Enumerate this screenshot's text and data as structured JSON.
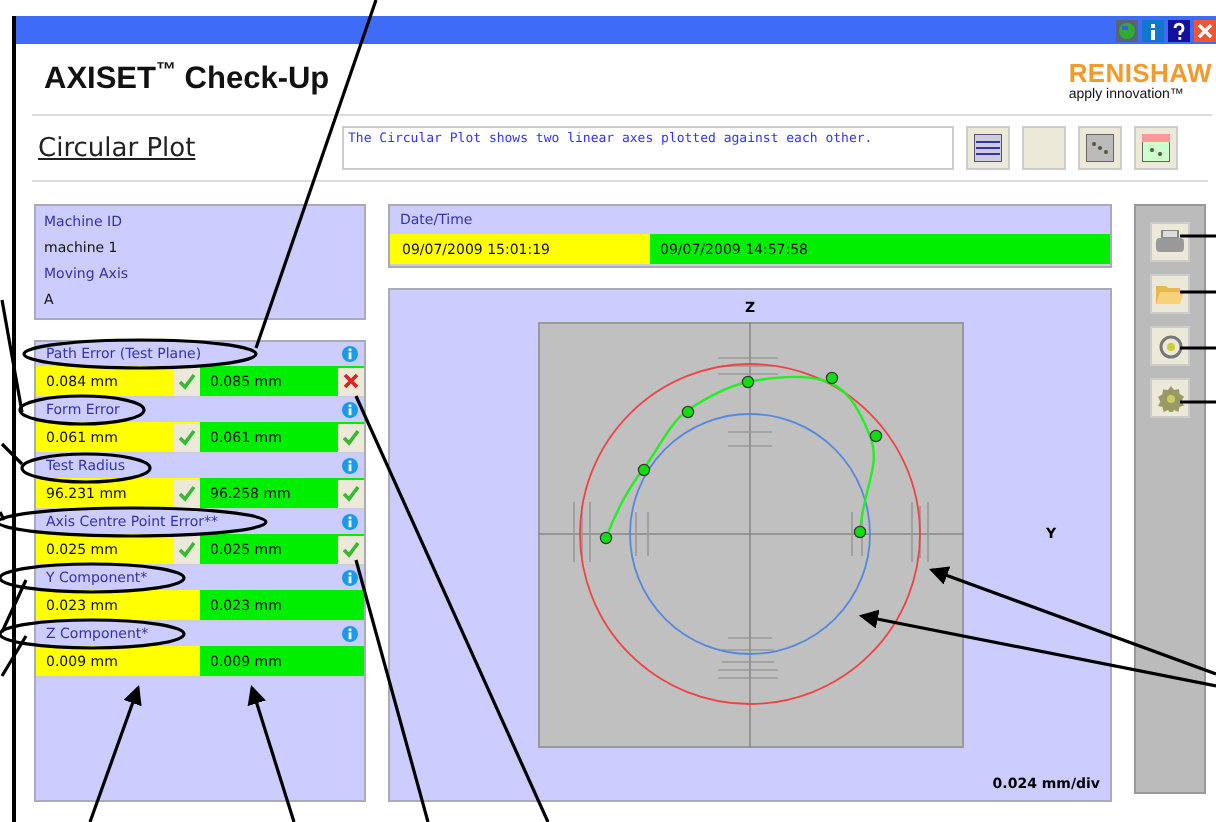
{
  "window": {
    "title_buttons": [
      {
        "kind": "globe"
      },
      {
        "kind": "info"
      },
      {
        "kind": "help"
      },
      {
        "kind": "close"
      }
    ]
  },
  "app": {
    "name": "AXISET",
    "tm": "™",
    "suffix": "Check-Up",
    "brand": "RENISHAW",
    "tagline": "apply innovation™"
  },
  "page": {
    "title": "Circular Plot",
    "description": "The Circular Plot shows two linear axes plotted against each other.",
    "view_buttons": [
      {
        "kind": "table"
      },
      {
        "kind": "blank"
      },
      {
        "kind": "scatter"
      },
      {
        "kind": "chart"
      }
    ]
  },
  "machine": [
    {
      "label": "Machine ID",
      "value": "machine 1"
    },
    {
      "label": "Moving Axis",
      "value": "A"
    }
  ],
  "results": [
    {
      "label": "Path Error (Test Plane)",
      "current": {
        "value": "0.084 mm",
        "passed": true
      },
      "previous": {
        "value": "0.085 mm",
        "passed": false
      }
    },
    {
      "label": "Form Error",
      "current": {
        "value": "0.061 mm",
        "passed": true
      },
      "previous": {
        "value": "0.061 mm",
        "passed": true
      }
    },
    {
      "label": "Test Radius",
      "current": {
        "value": "96.231 mm",
        "passed": true
      },
      "previous": {
        "value": "96.258 mm",
        "passed": true
      }
    },
    {
      "label": "Axis Centre Point Error**",
      "current": {
        "value": "0.025 mm",
        "passed": true
      },
      "previous": {
        "value": "0.025 mm",
        "passed": true
      }
    },
    {
      "label": "Y Component*",
      "current": {
        "value": "0.023 mm"
      },
      "previous": {
        "value": "0.023 mm"
      }
    },
    {
      "label": "Z Component*",
      "current": {
        "value": "0.009 mm"
      },
      "previous": {
        "value": "0.009 mm"
      }
    }
  ],
  "datetime": {
    "label": "Date/Time",
    "current": "09/07/2009 15:01:19",
    "previous": "09/07/2009 14:57:58"
  },
  "plot": {
    "vertical_axis": "Z",
    "horizontal_axis": "Y",
    "scale": "0.024 mm/div"
  },
  "tools": [
    {
      "kind": "print"
    },
    {
      "kind": "folder"
    },
    {
      "kind": "target"
    },
    {
      "kind": "gear"
    }
  ]
}
